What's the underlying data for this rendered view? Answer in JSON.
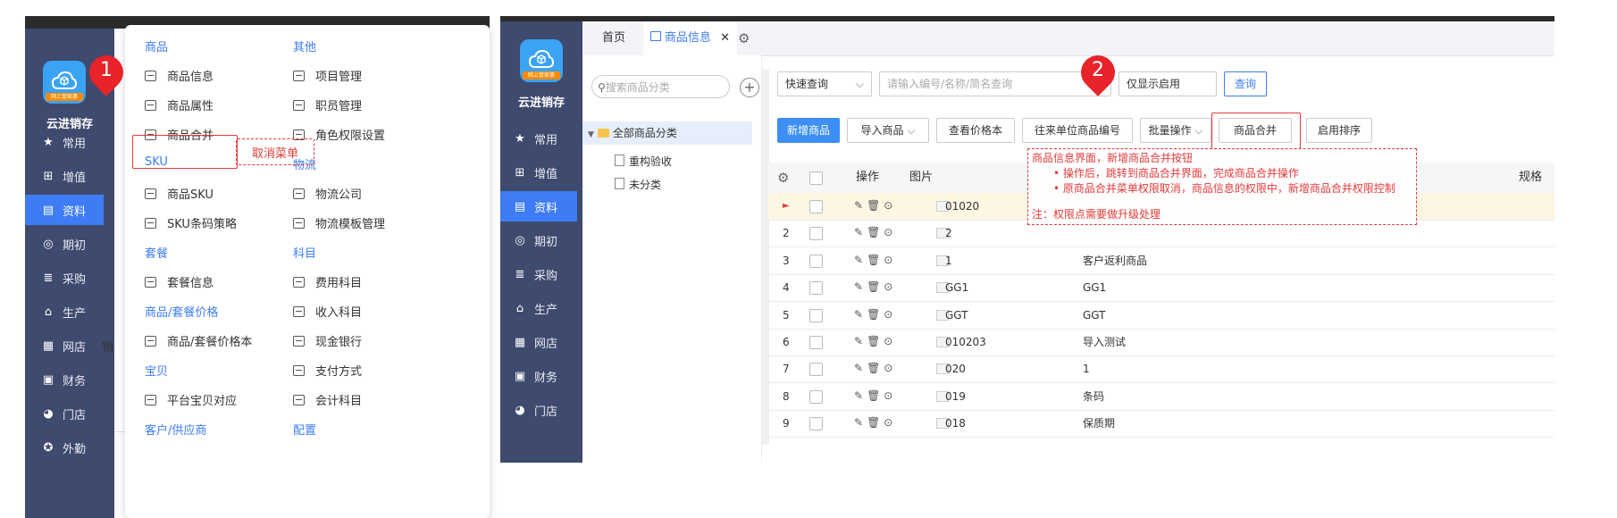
{
  "left": {
    "brand": "云进销存",
    "logo_tag": "网上管家婆",
    "sidebar": [
      {
        "label": "常用",
        "icon": "star-icon"
      },
      {
        "label": "增值",
        "icon": "plus-square-icon"
      },
      {
        "label": "资料",
        "icon": "document-icon",
        "active": true
      },
      {
        "label": "期初",
        "icon": "target-icon"
      },
      {
        "label": "采购",
        "icon": "cart-icon"
      },
      {
        "label": "生产",
        "icon": "factory-icon"
      },
      {
        "label": "网店",
        "icon": "shop-icon"
      },
      {
        "label": "财务",
        "icon": "finance-icon"
      },
      {
        "label": "门店",
        "icon": "pie-icon"
      },
      {
        "label": "外勤",
        "icon": "compass-icon"
      }
    ],
    "menu": {
      "col1": [
        {
          "type": "group",
          "label": "商品"
        },
        {
          "type": "item",
          "label": "商品信息"
        },
        {
          "type": "item",
          "label": "商品属性"
        },
        {
          "type": "item",
          "label": "商品合并"
        },
        {
          "type": "group",
          "label": "SKU"
        },
        {
          "type": "item",
          "label": "商品SKU"
        },
        {
          "type": "item",
          "label": "SKU条码策略"
        },
        {
          "type": "group",
          "label": "套餐"
        },
        {
          "type": "item",
          "label": "套餐信息"
        },
        {
          "type": "group",
          "label": "商品/套餐价格"
        },
        {
          "type": "item",
          "label": "商品/套餐价格本"
        },
        {
          "type": "group",
          "label": "宝贝"
        },
        {
          "type": "item",
          "label": "平台宝贝对应"
        },
        {
          "type": "group",
          "label": "客户/供应商"
        }
      ],
      "col2": [
        {
          "type": "group",
          "label": "其他"
        },
        {
          "type": "item",
          "label": "项目管理"
        },
        {
          "type": "item",
          "label": "职员管理"
        },
        {
          "type": "item",
          "label": "角色权限设置"
        },
        {
          "type": "group",
          "label": "物流"
        },
        {
          "type": "item",
          "label": "物流公司"
        },
        {
          "type": "item",
          "label": "物流模板管理"
        },
        {
          "type": "group",
          "label": "科目"
        },
        {
          "type": "item",
          "label": "费用科目"
        },
        {
          "type": "item",
          "label": "收入科目"
        },
        {
          "type": "item",
          "label": "现金银行"
        },
        {
          "type": "item",
          "label": "支付方式"
        },
        {
          "type": "item",
          "label": "会计科目"
        },
        {
          "type": "group",
          "label": "配置"
        }
      ]
    },
    "annotation_cancel": "取消菜单",
    "marker": "1",
    "behind_text": "销"
  },
  "right": {
    "brand": "云进销存",
    "logo_tag": "网上管家婆",
    "sidebar": [
      {
        "label": "常用",
        "icon": "star-icon"
      },
      {
        "label": "增值",
        "icon": "plus-square-icon"
      },
      {
        "label": "资料",
        "icon": "document-icon",
        "active": true
      },
      {
        "label": "期初",
        "icon": "target-icon"
      },
      {
        "label": "采购",
        "icon": "cart-icon"
      },
      {
        "label": "生产",
        "icon": "factory-icon"
      },
      {
        "label": "网店",
        "icon": "shop-icon"
      },
      {
        "label": "财务",
        "icon": "finance-icon"
      },
      {
        "label": "门店",
        "icon": "pie-icon"
      }
    ],
    "tabs": {
      "home": "首页",
      "current": "商品信息"
    },
    "tree": {
      "search_placeholder": "搜索商品分类",
      "root": "全部商品分类",
      "children": [
        "重构验收",
        "未分类"
      ]
    },
    "filter": {
      "quick": "快速查询",
      "keyword_placeholder": "请输入编号/名称/简名查询",
      "only_enabled": "仅显示启用",
      "query": "查询"
    },
    "toolbar": {
      "add": "新增商品",
      "import": "导入商品",
      "price_book": "查看价格本",
      "partner_code": "往来单位商品编号",
      "batch": "批量操作",
      "merge": "商品合并",
      "sort": "启用排序"
    },
    "table": {
      "headers": {
        "ops": "操作",
        "pic": "图片",
        "spec": "规格"
      },
      "rows": [
        {
          "idx": "►",
          "code": "01020",
          "name": ""
        },
        {
          "idx": "2",
          "code": "2",
          "name": ""
        },
        {
          "idx": "3",
          "code": "1",
          "name": "客户返利商品"
        },
        {
          "idx": "4",
          "code": "GG1",
          "name": "GG1"
        },
        {
          "idx": "5",
          "code": "GGT",
          "name": "GGT"
        },
        {
          "idx": "6",
          "code": "010203",
          "name": "导入测试"
        },
        {
          "idx": "7",
          "code": "020",
          "name": "1"
        },
        {
          "idx": "8",
          "code": "019",
          "name": "条码"
        },
        {
          "idx": "9",
          "code": "018",
          "name": "保质期"
        }
      ]
    },
    "note": {
      "title": "商品信息界面，新增商品合并按钮",
      "b1": "• 操作后，跳转到商品合并界面，完成商品合并操作",
      "b2": "• 原商品合并菜单权限取消，商品信息的权限中，新增商品合并权限控制",
      "footer": "注：权限点需要做升级处理"
    },
    "marker": "2"
  },
  "colors": {
    "sidebar": "#3e4a6e",
    "active": "#3d7cf4",
    "annotation": "#e23a3a",
    "marker": "#e8232a",
    "logo": "#3aa3f4"
  }
}
